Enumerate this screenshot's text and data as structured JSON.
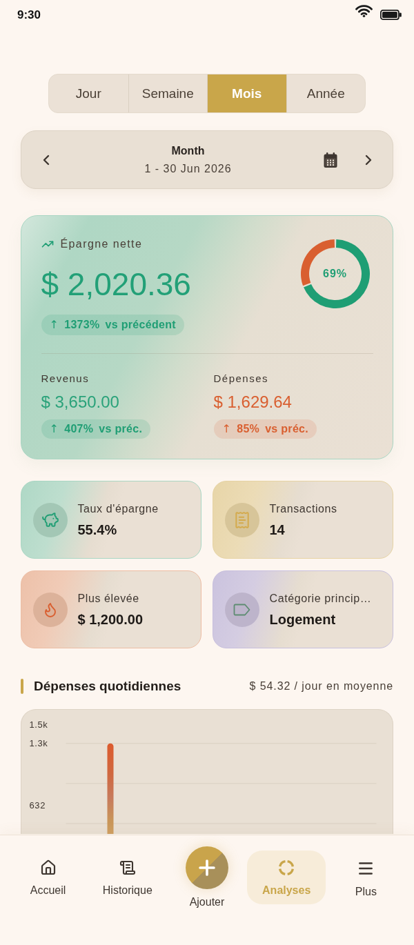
{
  "status_bar": {
    "time": "9:30"
  },
  "period_tabs": [
    {
      "label": "Jour",
      "selected": false
    },
    {
      "label": "Semaine",
      "selected": false
    },
    {
      "label": "Mois",
      "selected": true
    },
    {
      "label": "Année",
      "selected": false
    }
  ],
  "date_nav": {
    "title": "Month",
    "range": "1 - 30 Jun 2026"
  },
  "summary": {
    "label": "Épargne nette",
    "amount": "$ 2,020.36",
    "change": {
      "arrow": "↑",
      "percent": "1373%",
      "text": "vs précédent"
    },
    "donut": {
      "label": "69%",
      "chart_data": {
        "type": "donut",
        "values": [
          69,
          31
        ]
      }
    },
    "income": {
      "label": "Revenus",
      "amount": "$ 3,650.00",
      "change": {
        "arrow": "↑",
        "percent": "407%",
        "text": "vs préc."
      }
    },
    "expenses": {
      "label": "Dépenses",
      "amount": "$ 1,629.64",
      "change": {
        "arrow": "↑",
        "percent": "85%",
        "text": "vs préc."
      }
    }
  },
  "stat_cards": [
    {
      "kind": "savings_rate",
      "label": "Taux d'épargne",
      "value": "55.4%",
      "color": "#a9d6c3",
      "icon": {
        "color": "#1f9e74"
      }
    },
    {
      "kind": "transactions",
      "label": "Transactions",
      "value": "14",
      "color": "#e6d3a3",
      "icon": {
        "color": "#d4aa4c"
      }
    },
    {
      "kind": "highest",
      "label": "Plus élevée",
      "value": "$ 1,200.00",
      "color": "#ecbda4",
      "icon": {
        "color": "#d95f30"
      }
    },
    {
      "kind": "top_category",
      "label": "Catégorie princip…",
      "value": "Logement",
      "color": "#c7bfdd",
      "icon": {
        "color": "#5e8c72"
      }
    }
  ],
  "daily_spending": {
    "title": "Dépenses quotidiennes",
    "average": "$ 54.32 / jour en moyenne",
    "chart_data": {
      "type": "bar",
      "values": [
        1300
      ],
      "ylim": [
        0,
        1500
      ],
      "yticks": [
        {
          "value": 1500,
          "label": "1.5k"
        },
        {
          "value": 1300,
          "label": "1.3k"
        },
        {
          "value": 632,
          "label": "632"
        }
      ]
    }
  },
  "bottom_nav": [
    {
      "kind": "home",
      "label": "Accueil",
      "selected": false
    },
    {
      "kind": "history",
      "label": "Historique",
      "selected": false
    },
    {
      "kind": "add",
      "label": "Ajouter",
      "selected": false
    },
    {
      "kind": "analytics",
      "label": "Analyses",
      "selected": true
    },
    {
      "kind": "more",
      "label": "Plus",
      "selected": false
    }
  ]
}
